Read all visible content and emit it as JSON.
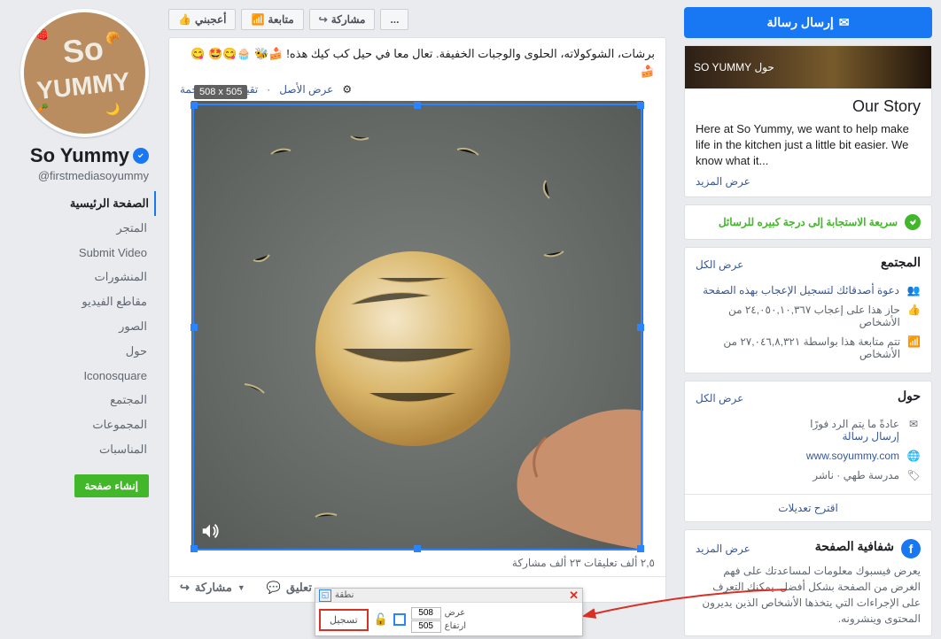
{
  "page": {
    "name": "So Yummy",
    "username": "firstmediasoyummy@",
    "nav": {
      "home": "الصفحة الرئيسية",
      "shop": "المتجر",
      "submit": "Submit Video",
      "posts": "المنشورات",
      "videos": "مقاطع الفيديو",
      "photos": "الصور",
      "about": "حول",
      "iconosquare": "Iconosquare",
      "community": "المجتمع",
      "groups": "المجموعات",
      "events": "المناسبات"
    },
    "create_page": "إنشاء صفحة"
  },
  "actions": {
    "like": "أعجبني",
    "follow": "متابعة",
    "share": "مشاركة",
    "more": "..."
  },
  "post": {
    "text": "برشات، الشوكولاته، الحلوى والوجبات الخفيفة. تعال معا في حيل كب كيك هذه! 🍰🐝 🧁😋🤩 😋🍰",
    "show_original": "عرض الأصل",
    "rate_translation": "تقييم هذه الترجمة",
    "stats": "٢,٥ ألف تعليقات ٢٣ ألف مشاركة",
    "comment_btn": "تعليق",
    "share_btn": "مشاركة"
  },
  "selection": {
    "label": "508 x 505",
    "width": "508",
    "height": "505"
  },
  "capture": {
    "title": "نطقة",
    "record": "تسجيل",
    "width_label": "عرض",
    "height_label": "ارتفاع"
  },
  "leftcol": {
    "send_message": "إرسال رسالة",
    "about_cover": "حول SO YUMMY",
    "our_story": "Our Story",
    "story_text": "Here at So Yummy, we want to help make life in the kitchen just a little bit easier. We know what it...",
    "see_more": "عرض المزيد",
    "response": "سريعة الاستجابة إلى درجة كبيره للرسائل",
    "community": {
      "title": "المجتمع",
      "see_all": "عرض الكل",
      "invite": "دعوة أصدقائك لتسجيل الإعجاب بهذه الصفحة",
      "likes": "حاز هذا على إعجاب ٢٤,٠٥٠,١٠,٣٦٧ من الأشخاص",
      "follows": "تتم متابعة هذا بواسطة ٢٧,٠٤٦,٨,٣٢١ من الأشخاص"
    },
    "about": {
      "title": "حول",
      "see_all": "عرض الكل",
      "reply": "عادةً ما يتم الرد فورًا",
      "send_msg": "إرسال رسالة",
      "website": "www.soyummy.com",
      "school": "مدرسة طهي · ناشر",
      "suggest": "اقترح تعديلات"
    },
    "transparency": {
      "title": "شفافية الصفحة",
      "see_more": "عرض المزيد",
      "text": "يعرض فيسبوك معلومات لمساعدتك على فهم الغرض من الصفحة بشكل أفضل. يمكنك التعرف على الإجراءات التي يتخذها الأشخاص الذين يديرون المحتوى وينشرونه."
    }
  }
}
